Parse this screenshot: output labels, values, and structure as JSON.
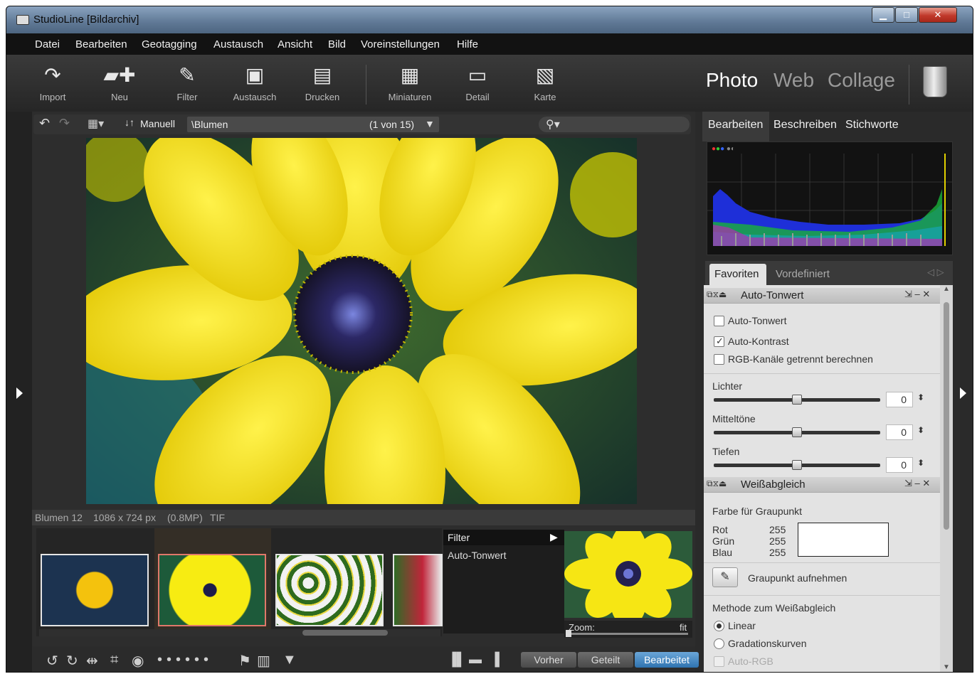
{
  "window": {
    "title": "StudioLine [Bildarchiv]",
    "minimize": "▁",
    "maximize": "□",
    "close": "✕"
  },
  "menu": [
    "Datei",
    "Bearbeiten",
    "Geotagging",
    "Austausch",
    "Ansicht",
    "Bild",
    "Voreinstellungen",
    "Hilfe"
  ],
  "toolbar": {
    "buttons": [
      {
        "label": "Import",
        "icon": "import-arrow-icon"
      },
      {
        "label": "Neu",
        "icon": "new-folder-icon"
      },
      {
        "label": "Filter",
        "icon": "filter-pipette-icon"
      },
      {
        "label": "Austausch",
        "icon": "exchange-icon"
      },
      {
        "label": "Drucken",
        "icon": "printer-icon"
      },
      {
        "label": "Miniaturen",
        "icon": "thumbnails-grid-icon"
      },
      {
        "label": "Detail",
        "icon": "detail-view-icon"
      },
      {
        "label": "Karte",
        "icon": "map-icon"
      }
    ],
    "modes": [
      "Photo",
      "Web",
      "Collage"
    ],
    "active_mode": "Photo"
  },
  "nav": {
    "sort_label": "Manuell",
    "path": "\\Blumen",
    "count": "(1 von 15)"
  },
  "image_info": {
    "name": "Blumen 12",
    "dimensions": "1086 x 724 px",
    "megapixels": "(0.8MP)",
    "format": "TIF"
  },
  "filter_panel": {
    "header": "Filter",
    "items": [
      "Auto-Tonwert"
    ]
  },
  "zoom": {
    "label": "Zoom:",
    "value_label": "fit"
  },
  "view_buttons": [
    "Vorher",
    "Geteilt",
    "Bearbeitet"
  ],
  "active_view": "Bearbeitet",
  "right_tabs": [
    "Bearbeiten",
    "Beschreiben",
    "Stichworte"
  ],
  "sub_tabs": [
    "Favoriten",
    "Vordefiniert"
  ],
  "auto_tonwert": {
    "title": "Auto-Tonwert",
    "options": [
      {
        "label": "Auto-Tonwert",
        "checked": false
      },
      {
        "label": "Auto-Kontrast",
        "checked": true
      },
      {
        "label": "RGB-Kanäle getrennt berechnen",
        "checked": false
      }
    ],
    "sliders": [
      {
        "label": "Lichter",
        "value": "0"
      },
      {
        "label": "Mitteltöne",
        "value": "0"
      },
      {
        "label": "Tiefen",
        "value": "0"
      }
    ]
  },
  "weissabgleich": {
    "title": "Weißabgleich",
    "gray_label": "Farbe für Graupunkt",
    "rgb": [
      {
        "label": "Rot",
        "value": "255"
      },
      {
        "label": "Grün",
        "value": "255"
      },
      {
        "label": "Blau",
        "value": "255"
      }
    ],
    "pick_label": "Graupunkt aufnehmen",
    "method_label": "Methode zum Weißabgleich",
    "methods": [
      {
        "label": "Linear",
        "selected": true
      },
      {
        "label": "Gradationskurven",
        "selected": false
      }
    ],
    "auto_rgb": "Auto-RGB"
  }
}
